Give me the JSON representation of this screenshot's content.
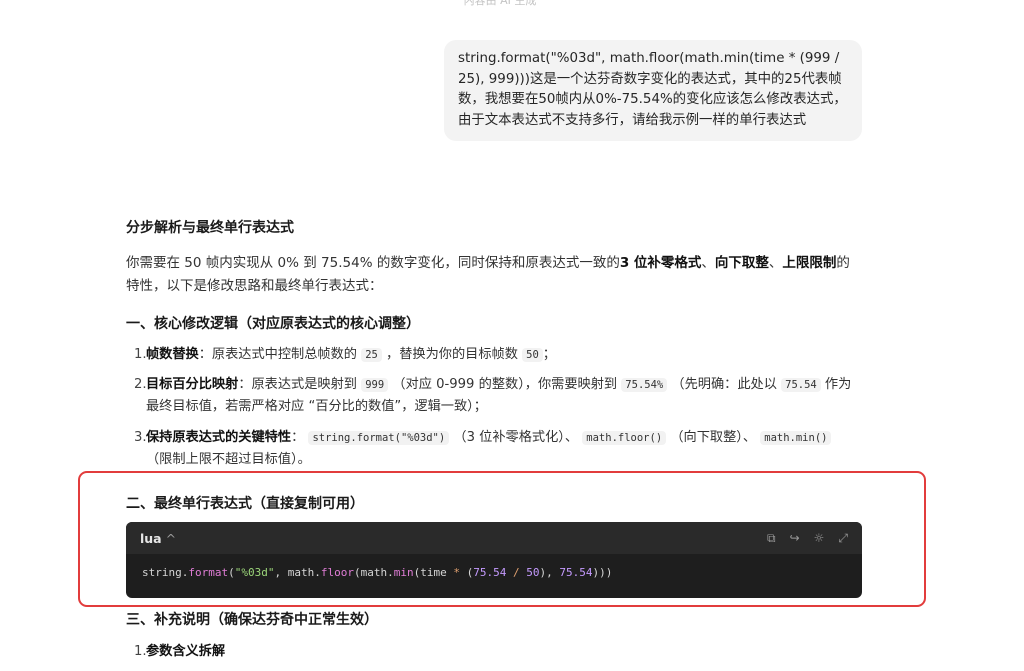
{
  "top_note": "内容由 AI 生成",
  "user_message": "string.format(\"%03d\", math.floor(math.min(time * (999 / 25), 999)))这是一个达芬奇数字变化的表达式，其中的25代表帧数，我想要在50帧内从0%-75.54%的变化应该怎么修改表达式，由于文本表达式不支持多行，请给我示例一样的单行表达式",
  "answer": {
    "title": "分步解析与最终单行表达式",
    "intro": {
      "a": "你需要在 50 帧内实现从 0% 到 75.54% 的数字变化，同时保持和原表达式一致的",
      "b1": "3 位补零格式",
      "sep1": "、",
      "b2": "向下取整",
      "sep2": "、",
      "b3": "上限限制",
      "c": "的特性，以下是修改思路和最终单行表达式："
    },
    "section1_title": "一、核心修改逻辑（对应原表达式的核心调整）",
    "steps": [
      {
        "num": "1.",
        "title": "帧数替换",
        "text_a": "：原表达式中控制总帧数的 ",
        "code_a": "25",
        "text_b": " ，替换为你的目标帧数 ",
        "code_b": "50",
        "text_c": "；"
      },
      {
        "num": "2.",
        "title": "目标百分比映射",
        "text_a": "：原表达式是映射到 ",
        "code_a": "999",
        "text_b": " （对应 0-999 的整数），你需要映射到 ",
        "code_b": "75.54%",
        "text_c": " （先明确：此处以 ",
        "code_c": "75.54",
        "text_d": " 作为最终目标值，若需严格对应 “百分比的数值”，逻辑一致）；"
      },
      {
        "num": "3.",
        "title": "保持原表达式的关键特性",
        "text_a": "： ",
        "code_a": "string.format(\"%03d\")",
        "text_b": " （3 位补零格式化）、 ",
        "code_b": "math.floor()",
        "text_c": " （向下取整）、 ",
        "code_c": "math.min()",
        "text_d": " （限制上限不超过目标值）。"
      }
    ],
    "section2_title": "二、最终单行表达式（直接复制可用）",
    "code_block": {
      "lang": "lua",
      "chev": "^",
      "tools": [
        "⧉",
        "↪",
        "☼",
        "⤢"
      ],
      "tokens": {
        "t1": "string.",
        "t2": "format",
        "t3": "(",
        "t4": "\"%03d\"",
        "t5": ", math.",
        "t6": "floor",
        "t7": "(math.",
        "t8": "min",
        "t9": "(time ",
        "t10": "*",
        "t11": " (",
        "t12": "75.54",
        "t13": " / ",
        "t14": "50",
        "t15": "), ",
        "t16": "75.54",
        "t17": ")))"
      }
    },
    "section3_title": "三、补充说明（确保达芬奇中正常生效）",
    "sub_item": {
      "num": "1.",
      "title": "参数含义拆解"
    }
  },
  "colors": {
    "highlight": "#e23c3c",
    "code_bg": "#1e1e1e",
    "bubble_bg": "#f3f3f3"
  }
}
